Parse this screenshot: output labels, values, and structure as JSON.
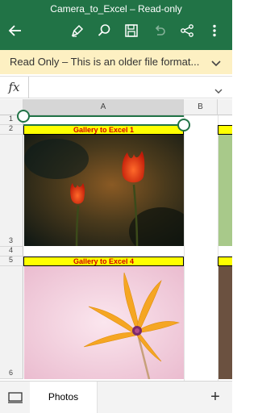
{
  "titlebar": {
    "title": "Camera_to_Excel – Read-only",
    "icons": [
      "back-arrow-icon",
      "pen-icon",
      "search-icon",
      "save-icon",
      "undo-icon",
      "share-icon",
      "more-icon"
    ]
  },
  "banner": {
    "text": "Read Only – This is an older file format...",
    "icon": "chevron-down-icon"
  },
  "formula_bar": {
    "fx_label": "fx",
    "value": ""
  },
  "sheet": {
    "columns": [
      "A",
      "B"
    ],
    "selected_column": "A",
    "rows": [
      "1",
      "2",
      "3",
      "4",
      "5",
      "6"
    ],
    "cells": {
      "a2": "Gallery to Excel 1",
      "a5": "Gallery to Excel 4"
    }
  },
  "tabs": {
    "items": [
      {
        "label": "Photos"
      }
    ],
    "add_label": "+"
  },
  "colors": {
    "accent": "#217346",
    "banner_bg": "#fdf0c2",
    "cell_fill": "#ffff00",
    "cell_text": "#d40000"
  }
}
